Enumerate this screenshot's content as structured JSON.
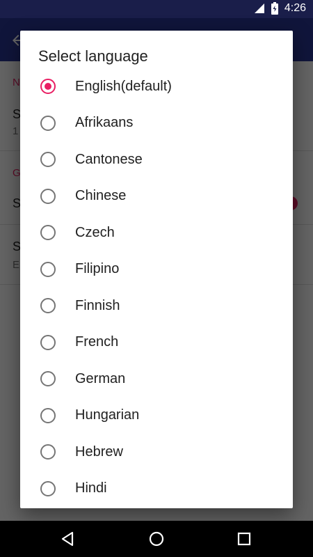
{
  "status_bar": {
    "time": "4:26",
    "icons": [
      "signal-icon",
      "battery-icon"
    ]
  },
  "dialog": {
    "title": "Select language",
    "options": [
      {
        "label": "English(default)",
        "selected": true
      },
      {
        "label": "Afrikaans",
        "selected": false
      },
      {
        "label": "Cantonese",
        "selected": false
      },
      {
        "label": "Chinese",
        "selected": false
      },
      {
        "label": "Czech",
        "selected": false
      },
      {
        "label": "Filipino",
        "selected": false
      },
      {
        "label": "Finnish",
        "selected": false
      },
      {
        "label": "French",
        "selected": false
      },
      {
        "label": "German",
        "selected": false
      },
      {
        "label": "Hungarian",
        "selected": false
      },
      {
        "label": "Hebrew",
        "selected": false
      },
      {
        "label": "Hindi",
        "selected": false
      }
    ]
  },
  "background_app": {
    "section1_header": "N",
    "pref1_title": "S",
    "pref1_summary": "1",
    "section2_header": "G",
    "pref2_title": "S",
    "pref3_title": "S",
    "pref3_summary": "E"
  },
  "nav_bar": {
    "icons": [
      "back-icon",
      "home-icon",
      "recents-icon"
    ]
  },
  "colors": {
    "accent": "#e91e63",
    "status_bar": "#1a1e4a",
    "app_bar": "#283593"
  }
}
